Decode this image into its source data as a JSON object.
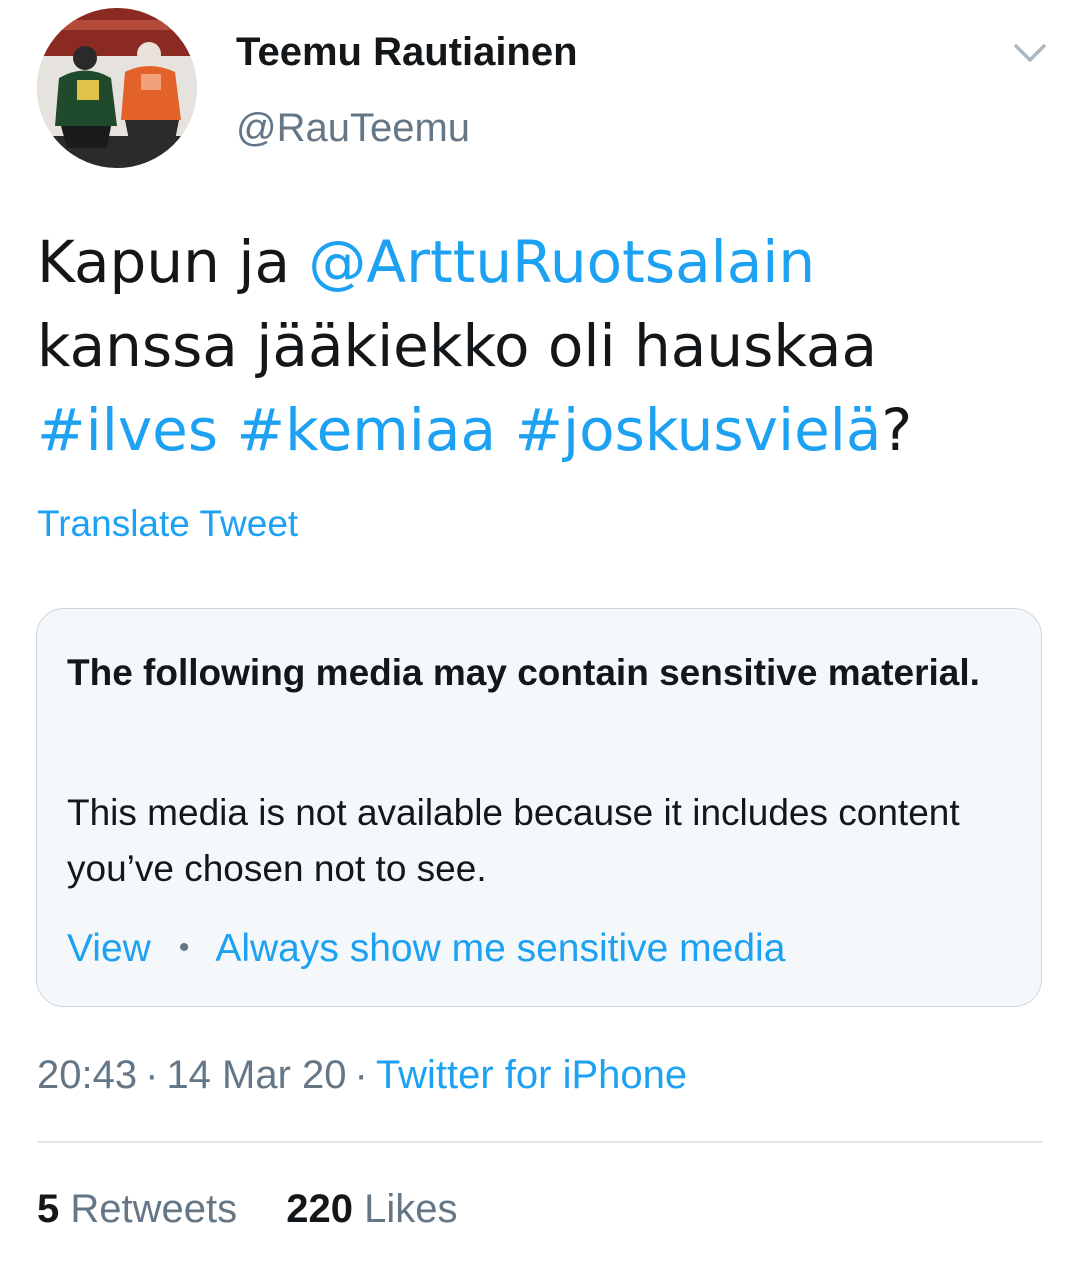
{
  "author": {
    "display_name": "Teemu Rautiainen",
    "handle": "@RauTeemu",
    "avatar_icon": "avatar-photo-hockey-players"
  },
  "header": {
    "menu_icon": "chevron-down-icon"
  },
  "tweet": {
    "text_line1_prefix": "Kapun ja ",
    "mention": "@ArttuRuotsalain",
    "text_line2": "kanssa jääkiekko oli hauskaa",
    "hashtags": [
      "#ilves",
      "#kemiaa",
      "#joskusvielä"
    ],
    "text_suffix": "?"
  },
  "translate_label": "Translate Tweet",
  "sensitive_notice": {
    "title": "The following media may contain sensitive material.",
    "body": "This media is not available because it includes content you’ve chosen not to see.",
    "view_label": "View",
    "separator": "•",
    "always_show_label": "Always show me sensitive media"
  },
  "meta": {
    "time": "20:43",
    "date": "14 Mar 20",
    "separator": "·",
    "source": "Twitter for iPhone"
  },
  "stats": {
    "retweets_count": "5",
    "retweets_label": "Retweets",
    "likes_count": "220",
    "likes_label": "Likes"
  },
  "colors": {
    "link": "#1da1f2",
    "secondary_text": "#657786",
    "primary_text": "#14171a",
    "card_background": "#f5f8fa",
    "card_border": "#ccd6dd"
  }
}
